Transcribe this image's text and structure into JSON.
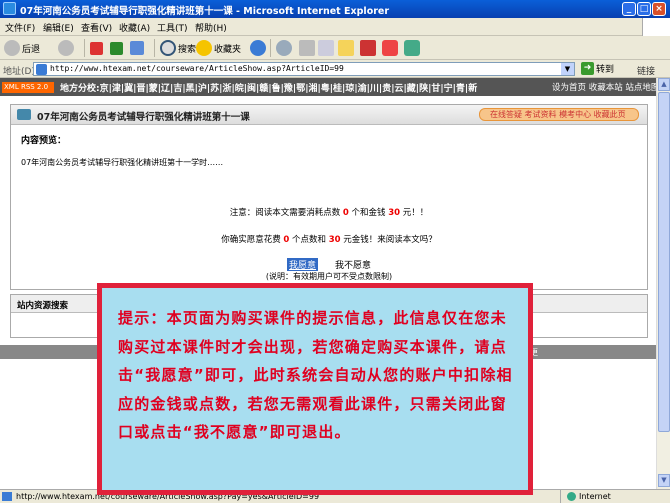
{
  "window": {
    "title": "07年河南公务员考试辅导行职强化精讲班第十一课 - Microsoft Internet Explorer",
    "min": "_",
    "max": "□",
    "close": "×"
  },
  "menu": [
    "文件(F)",
    "编辑(E)",
    "查看(V)",
    "收藏(A)",
    "工具(T)",
    "帮助(H)"
  ],
  "toolbar": {
    "back": "后退",
    "search": "搜索",
    "favorites": "收藏夹"
  },
  "address": {
    "label": "地址(D)",
    "url": "http://www.htexam.net/courseware/ArticleShow.asp?ArticleID=99",
    "go": "转到",
    "links": "链接"
  },
  "nav": {
    "rss": "XML RSS 2.0",
    "provinces": "地方分校:京|津|冀|晋|蒙|辽|吉|黑|沪|苏|浙|皖|闽|赣|鲁|豫|鄂|湘|粤|桂|琼|渝|川|贵|云|藏|陕|甘|宁|青|新",
    "right": "设为首页 收藏本站 站点地图"
  },
  "panel": {
    "title": "07年河南公务员考试辅导行职强化精讲班第十一课",
    "link": "在线答疑 考试资料 模考中心 收藏此页"
  },
  "preview": {
    "label": "内容预览：",
    "text": "07年河南公务员考试辅导行职强化精讲班第十一学时……"
  },
  "notice": {
    "a1": "注意：阅读本文需要消耗点数",
    "points": "0",
    "a2": "个和金钱",
    "money": "30",
    "a3": "元！！",
    "b1": "你确实愿意花费",
    "b2": "个点数和",
    "b3": "元金钱！来阅读本文吗？"
  },
  "options": {
    "yes": "我愿意",
    "no": "我不愿意",
    "note": "(说明：有效期用户可不受点数限制)"
  },
  "resources": {
    "title": "站内资源搜索"
  },
  "footer_text": "更",
  "overlay": {
    "text": "提示：本页面为购买课件的提示信息，此信息仅在您未购买过本课件时才会出现，若您确定购买本课件，请点击“我愿意”即可，此时系统会自动从您的账户中扣除相应的金钱或点数，若您无需观看此课件，只需关闭此窗口或点击“我不愿意”即可退出。"
  },
  "status": {
    "url": "http://www.htexam.net/courseware/ArticleShow.asp?Pay=yes&ArticleID=99",
    "zone": "Internet"
  }
}
